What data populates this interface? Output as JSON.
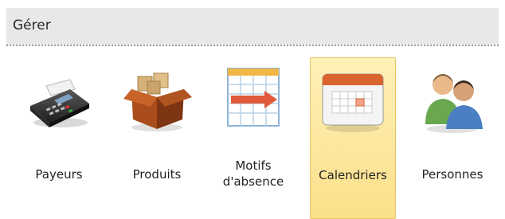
{
  "section": {
    "title": "Gérer"
  },
  "tiles": [
    {
      "label": "Payeurs",
      "icon": "payment-terminal-icon",
      "selected": false
    },
    {
      "label": "Produits",
      "icon": "product-box-icon",
      "selected": false
    },
    {
      "label_line1": "Motifs",
      "label_line2": "d'absence",
      "icon": "absence-reasons-icon",
      "selected": false
    },
    {
      "label": "Calendriers",
      "icon": "calendar-icon",
      "selected": true
    },
    {
      "label": "Personnes",
      "icon": "people-icon",
      "selected": false
    }
  ],
  "colors": {
    "header_bg": "#e8e8e8",
    "selected_tile_bg": "#fbe08a",
    "selected_tile_border": "#e6c463"
  }
}
